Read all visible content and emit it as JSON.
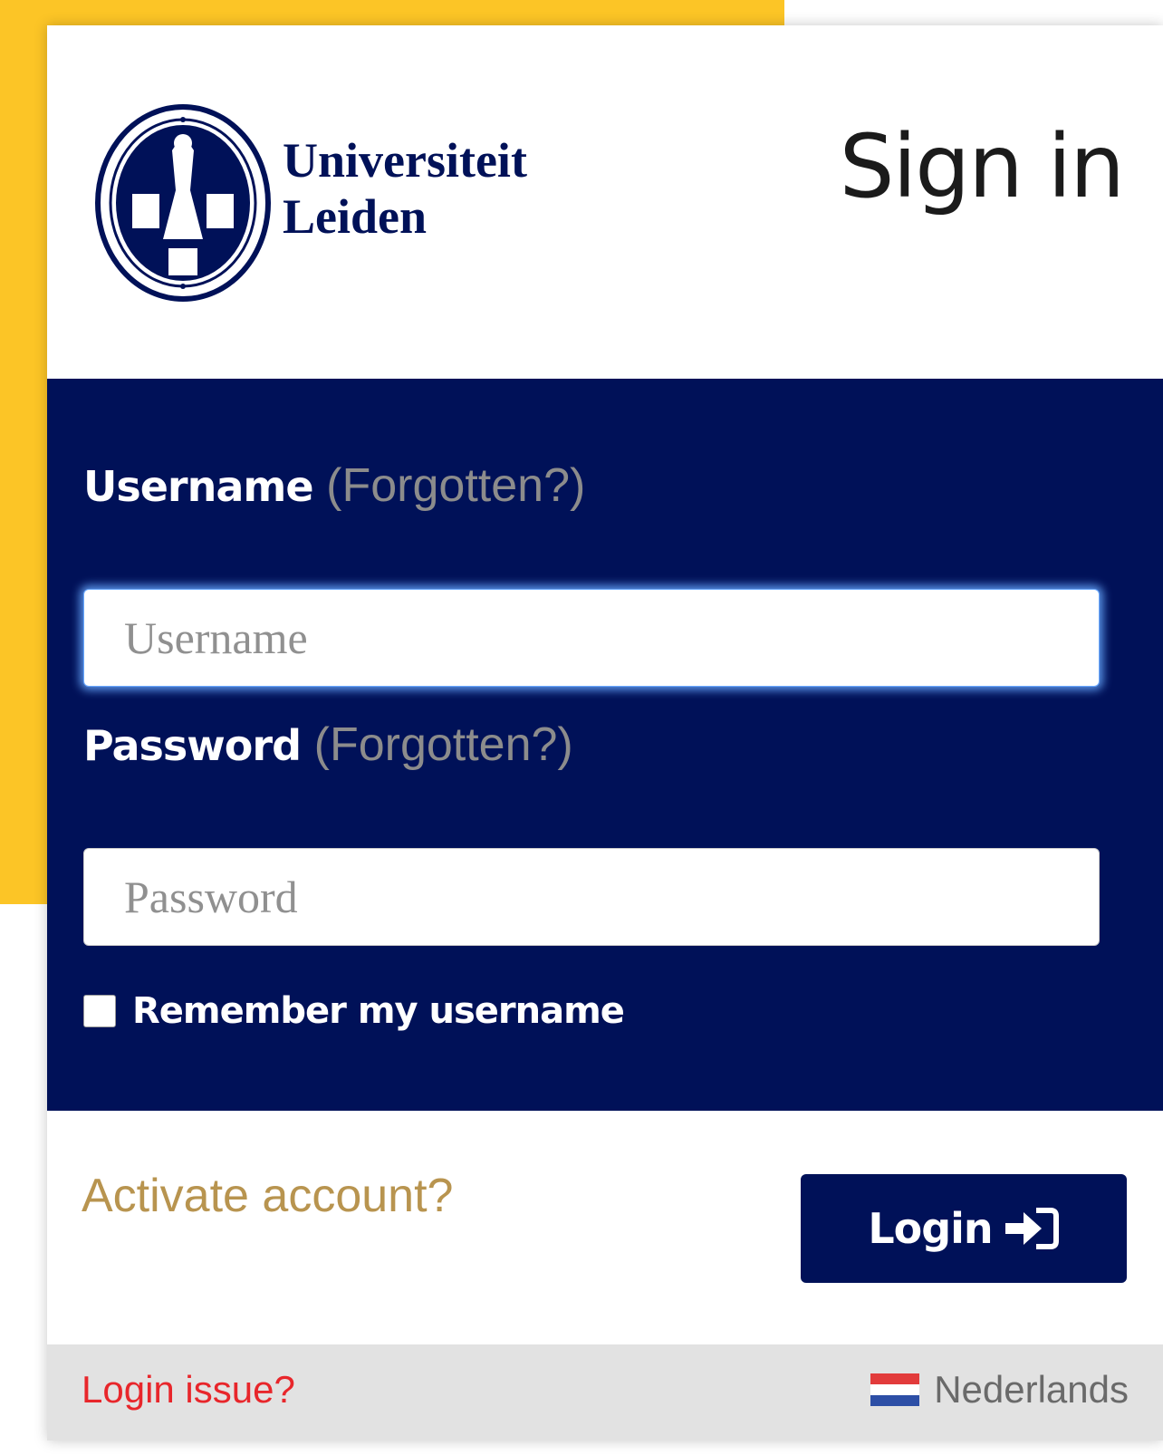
{
  "header": {
    "logo_line1": "Universiteit",
    "logo_line2": "Leiden",
    "title": "Sign in"
  },
  "form": {
    "username_label": "Username",
    "username_forgot": "(Forgotten?)",
    "username_placeholder": "Username",
    "username_value": "",
    "password_label": "Password",
    "password_forgot": "(Forgotten?)",
    "password_placeholder": "Password",
    "password_value": "",
    "remember_label": "Remember my username",
    "remember_checked": false
  },
  "actions": {
    "activate_label": "Activate account?",
    "login_label": "Login"
  },
  "footer": {
    "issue_label": "Login issue?",
    "language_label": "Nederlands"
  },
  "colors": {
    "navy": "#001158",
    "yellow_accent": "#fcc526",
    "activate_gold": "#b8944f",
    "issue_red": "#e8262b"
  },
  "icons": {
    "logo": "leiden-seal-icon",
    "login": "sign-in-arrow-icon",
    "language": "dutch-flag-icon"
  }
}
